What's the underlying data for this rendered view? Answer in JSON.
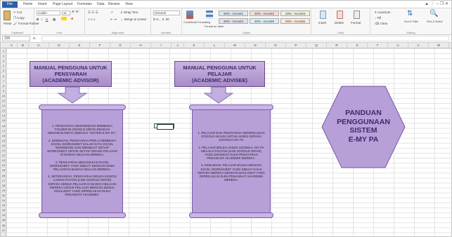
{
  "ribbon_tabs": {
    "file": "File",
    "home": "Home",
    "insert": "Insert",
    "page_layout": "Page Layout",
    "formulas": "Formulas",
    "data": "Data",
    "review": "Review",
    "view": "View"
  },
  "clipboard": {
    "cut": "Cut",
    "copy": "Copy",
    "paste": "Paste",
    "format_painter": "Format Painter",
    "label": "Clipboard"
  },
  "font": {
    "name": "Calibri",
    "size": "11",
    "label": "Font"
  },
  "alignment": {
    "wrap": "Wrap Text",
    "merge": "Merge & Center",
    "label": "Alignment"
  },
  "number": {
    "format": "General",
    "label": "Number"
  },
  "styles": {
    "conditional": "Conditional Formatting",
    "format_table": "Format as Table",
    "accent_items": [
      "20% - Accent1",
      "20% - Accent2",
      "20% - Accent3",
      "20% - Accent4",
      "20% - Accent5",
      "20% - Accent6"
    ],
    "label": "Styles"
  },
  "cells": {
    "insert": "Insert",
    "delete": "Delete",
    "format": "Format",
    "label": "Cells"
  },
  "editing": {
    "autosum": "AutoSum",
    "fill": "Fill",
    "clear": "Clear",
    "sort": "Sort & Filter",
    "find": "Find & Select",
    "label": "Editing"
  },
  "formula_bar": {
    "cell_ref": "J16",
    "fx": "fx"
  },
  "columns": [
    "A",
    "B",
    "C",
    "D",
    "E",
    "F",
    "G",
    "H",
    "I",
    "J",
    "K",
    "L",
    "M",
    "N",
    "O",
    "P",
    "Q",
    "R",
    "S",
    "T",
    "U",
    "V",
    "W",
    "X",
    "Y",
    "Z",
    "AA"
  ],
  "rows": [
    "1",
    "2",
    "3",
    "4",
    "5",
    "6",
    "7",
    "8",
    "9",
    "10",
    "11",
    "12",
    "13",
    "14",
    "15",
    "16",
    "17",
    "18",
    "19",
    "20",
    "21",
    "22",
    "23",
    "24",
    "25",
    "26",
    "27",
    "28",
    "29",
    "30",
    "31",
    "32",
    "33",
    "34",
    "35",
    "36",
    "37"
  ],
  "banner_left": {
    "line1": "MANUAL PENGGUNA UNTUK",
    "line2": "PENSYARAH",
    "line3": "(ACADEMIC ADVISOR)"
  },
  "banner_right": {
    "line1": "MANUAL PENGGUNA UNTUK PELAJAR",
    "line2": "(ACADEMIC ADVISEE)"
  },
  "scroll_left": [
    "1. PENSYARAH DIKEHENDAKI MEMBUKA FOLDER DI GOOGLE DRIVE DENGAN MENAMAKANNYA SEBAGAI \"SISTEM E-MY PA\".",
    "2. KEMUDIAN, PENSYARAH PERLU MEMBUKA EXCEL WORKSHEET DALAM SATU EXCEL WORKBOOK DAN MEMBUAT SETIAP WORKSHEET UNTUK SETIAP ORANG PELAJAR DI BAWAH SELIAAN MEREKA.",
    "3. PENSYARAH MENAMAKAN EXCEL WORKSHEET YANG DIBUAT DENGAN NAMA PELAJAR DI BAWAH SELIAAN MEREKA.",
    "4. SETERUSNYA, PENSYARAH BOLEH KONGSI LAMAN PAUTAN (LINK GOOGLE DRIVE) KEPADA SEMUA PELAJAR DI BAWAH SELIAAN MEREKA UNTUK PELAJAR MENGISI SEMUA MAKLUMAT YANG DIPERLUKAN OLEH PENASIHAT AKADEMIK."
  ],
  "scroll_right": [
    "1. PELAJAR DAN PENSYARAH MEMERLUKAN GOOGLE AKAUN UNTUK AKSES KEPADA SISTEM E-MY PA",
    "2. PELAJAR BOLEH AKSES SISTEM e- MY PA MELALUI PAUTAN (LINK GOOGLE DRIVE) YANG DIKONGSI OLEH PENSYARAH PENASIHAT AKADEMIK MEREKA.",
    "3. KEMUDIAN, PELAJAR BOLEH MENGISI EXCEL WORKSHEET YANG DIBUAT KHAS KEPADA MEREKA DENGAN MAKLUMAT YANG DIPERLUKAN OLEH PENASIHAT AKADEMIK MEREKA."
  ],
  "hexagon": {
    "line1": "PANDUAN",
    "line2": "PENGGUNAAN",
    "line3": "SISTEM",
    "line4": "E-MY PA"
  },
  "colors": {
    "banner_fill": "#b89ddc",
    "scroll_fill": "#b79fd8",
    "hex_fill": "#b79fd8",
    "file_tab": "#2a5fa8"
  }
}
